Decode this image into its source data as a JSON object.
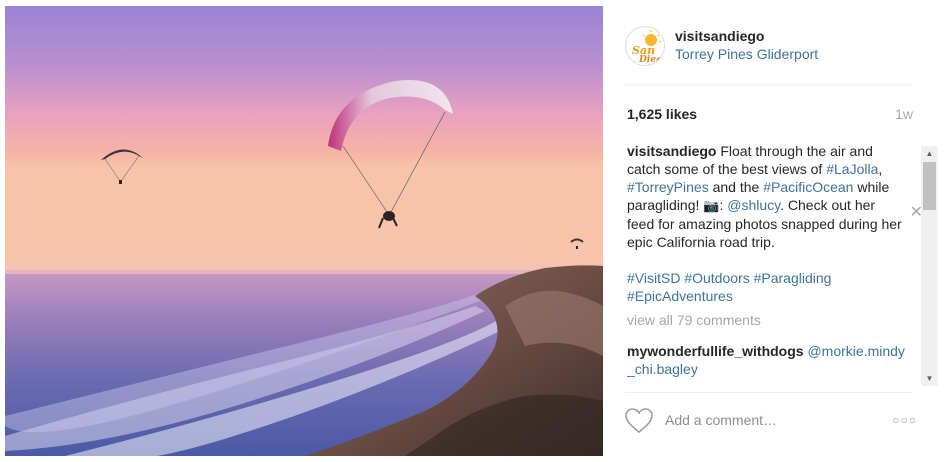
{
  "post": {
    "username": "visitsandiego",
    "location": "Torrey Pines Gliderport",
    "avatar_logo_text": "San Diego",
    "likes": "1,625 likes",
    "age": "1w"
  },
  "caption": {
    "username": "visitsandiego",
    "text_1": "Float through the air and catch some of the best views of",
    "tag_lajolla": "#LaJolla",
    "sep_1": ",",
    "tag_torreypines": "#TorreyPines",
    "text_2": "and the",
    "tag_pacificocean": "#PacificOcean",
    "text_3": "while paragliding!",
    "camera_glyph": "📷",
    "colon": ":",
    "mention_shlucy": "@shlucy",
    "text_4": ". Check out her feed for amazing photos snapped during her epic California road trip."
  },
  "hashtags": [
    "#VisitSD",
    "#Outdoors",
    "#Paragliding",
    "#EpicAdventures"
  ],
  "view_all_comments": "view all 79 comments",
  "comments": [
    {
      "username": "mywonderfullife_withdogs",
      "text": "@morkie.mindy_chi.bagley"
    }
  ],
  "add_comment_placeholder": "Add a comment…",
  "icons": {
    "like": "heart-icon",
    "more": "more-options-icon",
    "close": "close-icon",
    "camera": "camera-icon"
  },
  "colors": {
    "link": "#3f729b",
    "muted": "#a5a7aa",
    "text": "#262626",
    "divider": "#efefef"
  }
}
